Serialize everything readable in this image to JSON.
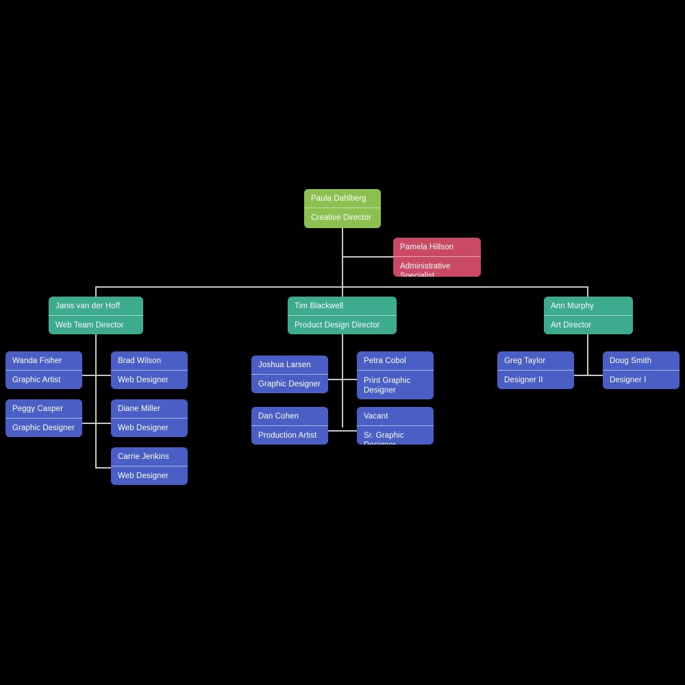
{
  "chart": {
    "type": "org-chart",
    "title": "Organizational Chart",
    "background_color": "#000000",
    "connector_color": "#c8c8c8",
    "colors": {
      "executive": "#8cc152",
      "assistant": "#ca4a63",
      "director": "#3cab8e",
      "staff": "#4a5fc5"
    }
  },
  "nodes": {
    "root": {
      "name": "Paula Dahlberg",
      "title": "Creative Director"
    },
    "assistant": {
      "name": "Pamela Hillson",
      "title": "Administrative Specialist"
    },
    "director_web": {
      "name": "Janis van der Hoff",
      "title": "Web Team Director"
    },
    "director_product": {
      "name": "Tim Blackwell",
      "title": "Product Design Director"
    },
    "director_art": {
      "name": "Ann Murphy",
      "title": "Art Director"
    },
    "web_1": {
      "name": "Wanda Fisher",
      "title": "Graphic Artist"
    },
    "web_2": {
      "name": "Brad Wilson",
      "title": "Web Designer"
    },
    "web_3": {
      "name": "Peggy Casper",
      "title": "Graphic Designer"
    },
    "web_4": {
      "name": "Diane Miller",
      "title": "Web Designer"
    },
    "web_5": {
      "name": "Carrie Jenkins",
      "title": "Web Designer"
    },
    "prod_1": {
      "name": "Joshua Larsen",
      "title": "Graphic Designer"
    },
    "prod_2": {
      "name": "Petra Cobol",
      "title": "Print Graphic Designer"
    },
    "prod_3": {
      "name": "Dan Cohen",
      "title": "Production Artist"
    },
    "prod_4": {
      "name": "Vacant",
      "title": "Sr. Graphic Designer"
    },
    "art_1": {
      "name": "Greg Taylor",
      "title": "Designer II"
    },
    "art_2": {
      "name": "Doug Smith",
      "title": "Designer I"
    }
  }
}
